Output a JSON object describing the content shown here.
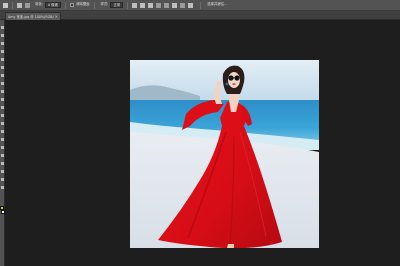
{
  "options_bar": {
    "feather_label": "羽化:",
    "feather_value": "0 像素",
    "antialias_label": "消除锯齿",
    "style_label": "样式:",
    "style_value": "正常",
    "select_mask_label": "选择并遮住..."
  },
  "document": {
    "tab_title": "Amy 宝宝.jpg @ 100%(RGB/8)",
    "close_glyph": "×"
  },
  "toolbar": {
    "foreground_color": "#e6d200",
    "background_color": "#ffffff"
  },
  "canvas": {
    "image_description": ""
  }
}
